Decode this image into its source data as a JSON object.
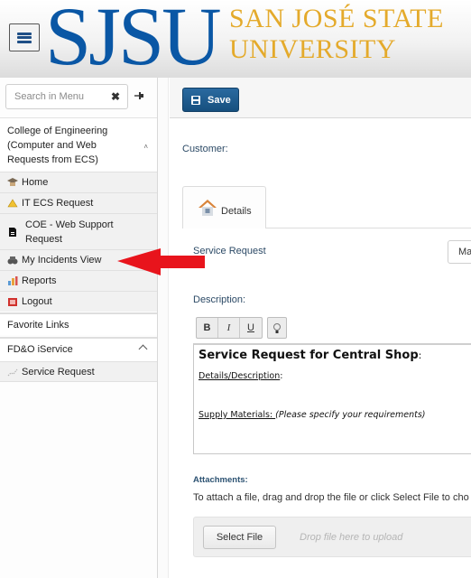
{
  "header": {
    "menu_button": "menu",
    "logo_short": "SJSU",
    "logo_line1": "SAN JOSÉ STATE",
    "logo_line2": "UNIVERSITY",
    "logo_blue": "#0a57a5",
    "logo_gold": "#e4aa2b"
  },
  "sidebar": {
    "search_placeholder": "Search in Menu",
    "search_value": "",
    "clear_icon": "✖",
    "section_title": "College of Engineering (Computer and Web Requests from ECS)",
    "items": [
      {
        "label": "Home",
        "icon": "graduation-cap-icon"
      },
      {
        "label": "IT ECS Request",
        "icon": "warning-icon"
      },
      {
        "label": "COE - Web Support Request",
        "icon": "document-icon"
      },
      {
        "label": "My Incidents View",
        "icon": "binoculars-icon"
      },
      {
        "label": "Reports",
        "icon": "bar-chart-icon"
      },
      {
        "label": "Logout",
        "icon": "logout-icon"
      }
    ],
    "favorite_links": "Favorite Links",
    "fdo_section": "FD&O iService",
    "fdo_items": [
      {
        "label": "Service Request",
        "icon": "chart-line-icon"
      }
    ]
  },
  "toolbar": {
    "save_label": "Save",
    "save_color": "#1d5b8e"
  },
  "form": {
    "customer_label": "Customer:",
    "tab_details": "Details",
    "service_request_label": "Service Request",
    "service_request_value": "Ma",
    "description_label": "Description:",
    "rte_buttons": [
      "B",
      "I",
      "U"
    ],
    "rte_heading": "Service Request for Central Shop",
    "rte_heading_suffix": ":",
    "rte_details_label": "Details/Description",
    "rte_details_suffix": ":",
    "rte_supply_label": "Supply Materials: ",
    "rte_supply_hint": "(Please specify your requirements)",
    "attachments_label": "Attachments:",
    "attachments_desc": "To attach a file, drag and drop the file or click Select File to cho",
    "select_file_label": "Select File",
    "drop_hint": "Drop file here to upload"
  },
  "annotation": {
    "arrow_color": "#e8141c",
    "arrow_points_to": "My Incidents View"
  }
}
